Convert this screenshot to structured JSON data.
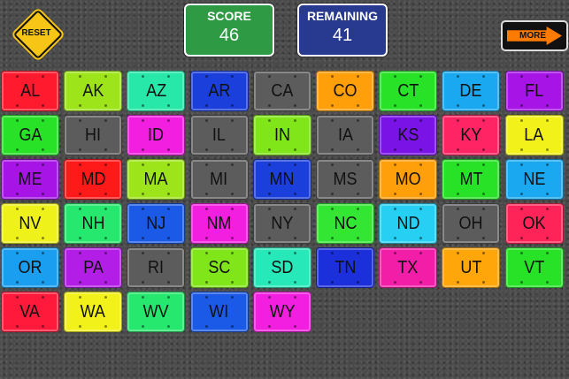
{
  "header": {
    "reset_label": "RESET",
    "score_title": "SCORE",
    "score_value": "46",
    "remaining_title": "REMAINING",
    "remaining_value": "41",
    "more_label": "MORE"
  },
  "colors": {
    "score_panel": "#2f9a44",
    "remaining_panel": "#283a8f",
    "reset_sign": "#f6c516",
    "more_arrow": "#ff7a00"
  },
  "plates": [
    {
      "abbr": "AL",
      "color": "#ff1a2e"
    },
    {
      "abbr": "AK",
      "color": "#9ee41b"
    },
    {
      "abbr": "AZ",
      "color": "#27e8a8"
    },
    {
      "abbr": "AR",
      "color": "#1b3fdb"
    },
    {
      "abbr": "CA",
      "color": "#5c5c5c"
    },
    {
      "abbr": "CO",
      "color": "#ff9f0a"
    },
    {
      "abbr": "CT",
      "color": "#27e227"
    },
    {
      "abbr": "DE",
      "color": "#1aa9f0"
    },
    {
      "abbr": "FL",
      "color": "#a614e6"
    },
    {
      "abbr": "GA",
      "color": "#27e227"
    },
    {
      "abbr": "HI",
      "color": "#5c5c5c"
    },
    {
      "abbr": "ID",
      "color": "#f21ee0"
    },
    {
      "abbr": "IL",
      "color": "#5c5c5c"
    },
    {
      "abbr": "IN",
      "color": "#80e61a"
    },
    {
      "abbr": "IA",
      "color": "#5c5c5c"
    },
    {
      "abbr": "KS",
      "color": "#7a14e6"
    },
    {
      "abbr": "KY",
      "color": "#ff2464"
    },
    {
      "abbr": "LA",
      "color": "#f2f21a"
    },
    {
      "abbr": "ME",
      "color": "#a614e6"
    },
    {
      "abbr": "MD",
      "color": "#ff1a1a"
    },
    {
      "abbr": "MA",
      "color": "#9ee41b"
    },
    {
      "abbr": "MI",
      "color": "#5c5c5c"
    },
    {
      "abbr": "MN",
      "color": "#1b3fdb"
    },
    {
      "abbr": "MS",
      "color": "#5c5c5c"
    },
    {
      "abbr": "MO",
      "color": "#ff9f0a"
    },
    {
      "abbr": "MT",
      "color": "#27e227"
    },
    {
      "abbr": "NE",
      "color": "#1aa9f0"
    },
    {
      "abbr": "NV",
      "color": "#eef21a"
    },
    {
      "abbr": "NH",
      "color": "#27e86e"
    },
    {
      "abbr": "NJ",
      "color": "#1b5ae6"
    },
    {
      "abbr": "NM",
      "color": "#f21ee0"
    },
    {
      "abbr": "NY",
      "color": "#5c5c5c"
    },
    {
      "abbr": "NC",
      "color": "#33e633"
    },
    {
      "abbr": "ND",
      "color": "#27d0f2"
    },
    {
      "abbr": "OH",
      "color": "#5c5c5c"
    },
    {
      "abbr": "OK",
      "color": "#ff2457"
    },
    {
      "abbr": "OR",
      "color": "#1a9ff0"
    },
    {
      "abbr": "PA",
      "color": "#b31ee6"
    },
    {
      "abbr": "RI",
      "color": "#5c5c5c"
    },
    {
      "abbr": "SC",
      "color": "#80e61a"
    },
    {
      "abbr": "SD",
      "color": "#27e8b8"
    },
    {
      "abbr": "TN",
      "color": "#1b2fdb"
    },
    {
      "abbr": "TX",
      "color": "#f21ea8"
    },
    {
      "abbr": "UT",
      "color": "#ffa60a"
    },
    {
      "abbr": "VT",
      "color": "#27e227"
    },
    {
      "abbr": "VA",
      "color": "#ff1a3c"
    },
    {
      "abbr": "WA",
      "color": "#f2f21a"
    },
    {
      "abbr": "WV",
      "color": "#27e86e"
    },
    {
      "abbr": "WI",
      "color": "#1b5ae6"
    },
    {
      "abbr": "WY",
      "color": "#f21ee0"
    }
  ]
}
